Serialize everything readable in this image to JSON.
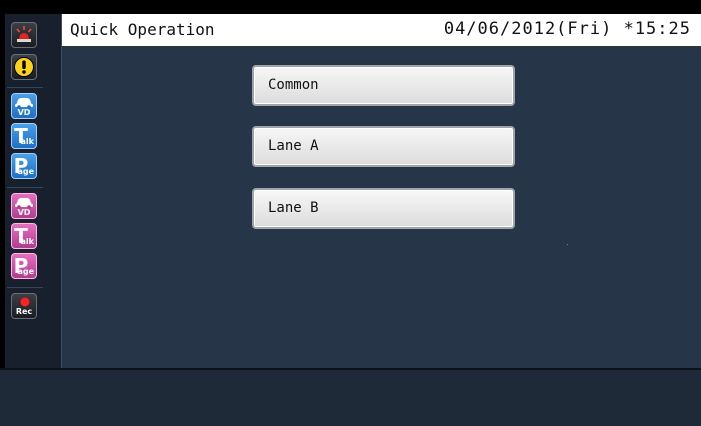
{
  "header": {
    "title": "Quick Operation",
    "datetime": "04/06/2012(Fri) *15:25"
  },
  "operations": [
    {
      "label": "Common"
    },
    {
      "label": "Lane A"
    },
    {
      "label": "Lane B"
    }
  ],
  "sidebar": {
    "items": [
      {
        "icon": "alarm-light-icon"
      },
      {
        "icon": "warning-icon"
      },
      {
        "icon": "vd-car-icon",
        "label": "VD",
        "color": "#2a7fd4"
      },
      {
        "icon": "talk-icon",
        "letter": "T",
        "suffix": "alk",
        "color": "#2a7fd4"
      },
      {
        "icon": "page-icon",
        "letter": "P",
        "suffix": "age",
        "color": "#2a7fd4"
      },
      {
        "icon": "vd-car-icon",
        "label": "VD",
        "color": "#c34fa0"
      },
      {
        "icon": "talk-icon",
        "letter": "T",
        "suffix": "alk",
        "color": "#c34fa0"
      },
      {
        "icon": "page-icon",
        "letter": "P",
        "suffix": "age",
        "color": "#c34fa0"
      },
      {
        "icon": "record-icon",
        "label": "Rec"
      }
    ]
  },
  "colors": {
    "background": "#263548",
    "header": "#ffffff",
    "sidebar": "#17202c",
    "lane_a_accent": "#2a7fd4",
    "lane_b_accent": "#c34fa0"
  }
}
